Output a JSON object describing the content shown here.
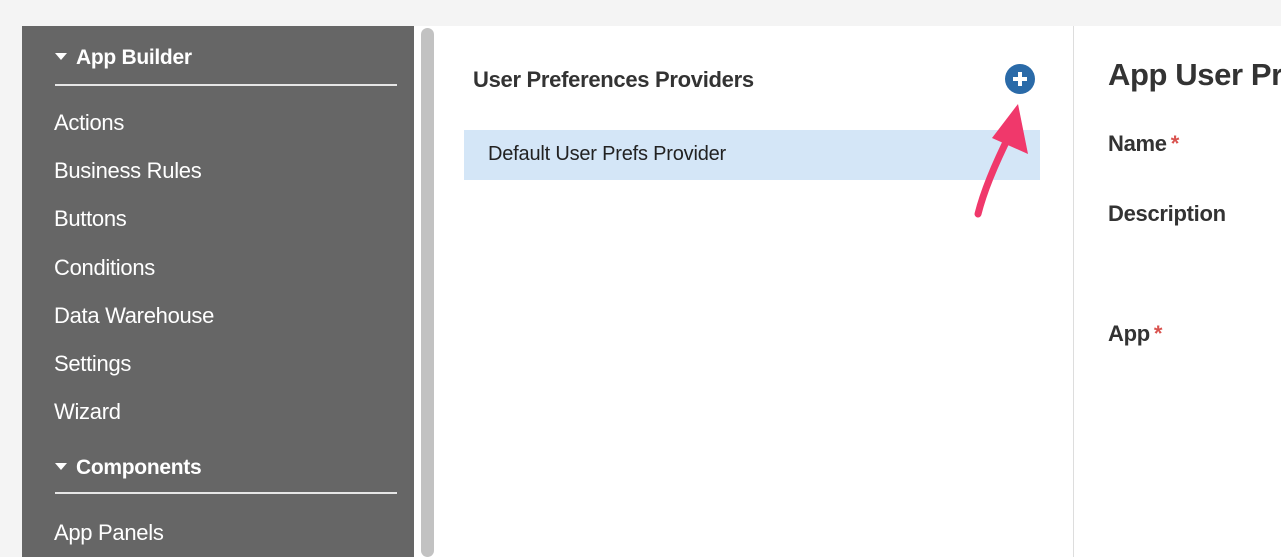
{
  "sidebar": {
    "sections": [
      {
        "label": "App Builder",
        "items": [
          {
            "label": "Actions"
          },
          {
            "label": "Business Rules"
          },
          {
            "label": "Buttons"
          },
          {
            "label": "Conditions"
          },
          {
            "label": "Data Warehouse"
          },
          {
            "label": "Settings"
          },
          {
            "label": "Wizard"
          }
        ]
      },
      {
        "label": "Components",
        "items": [
          {
            "label": "App Panels"
          }
        ]
      }
    ]
  },
  "list_panel": {
    "title": "User Preferences Providers",
    "add_icon": "plus-circle-icon",
    "items": [
      {
        "label": "Default User Prefs Provider",
        "selected": true
      }
    ]
  },
  "detail": {
    "title": "App User Preferences Provider",
    "fields": [
      {
        "label": "Name",
        "required_mark": "*"
      },
      {
        "label": "Description",
        "required_mark": ""
      },
      {
        "label": "App",
        "required_mark": "*"
      }
    ]
  },
  "colors": {
    "sidebar_bg": "#666666",
    "selected_row": "#d4e6f7",
    "add_button": "#2a6aa8",
    "annotation_arrow": "#f0386b",
    "required_mark": "#d9534f"
  }
}
